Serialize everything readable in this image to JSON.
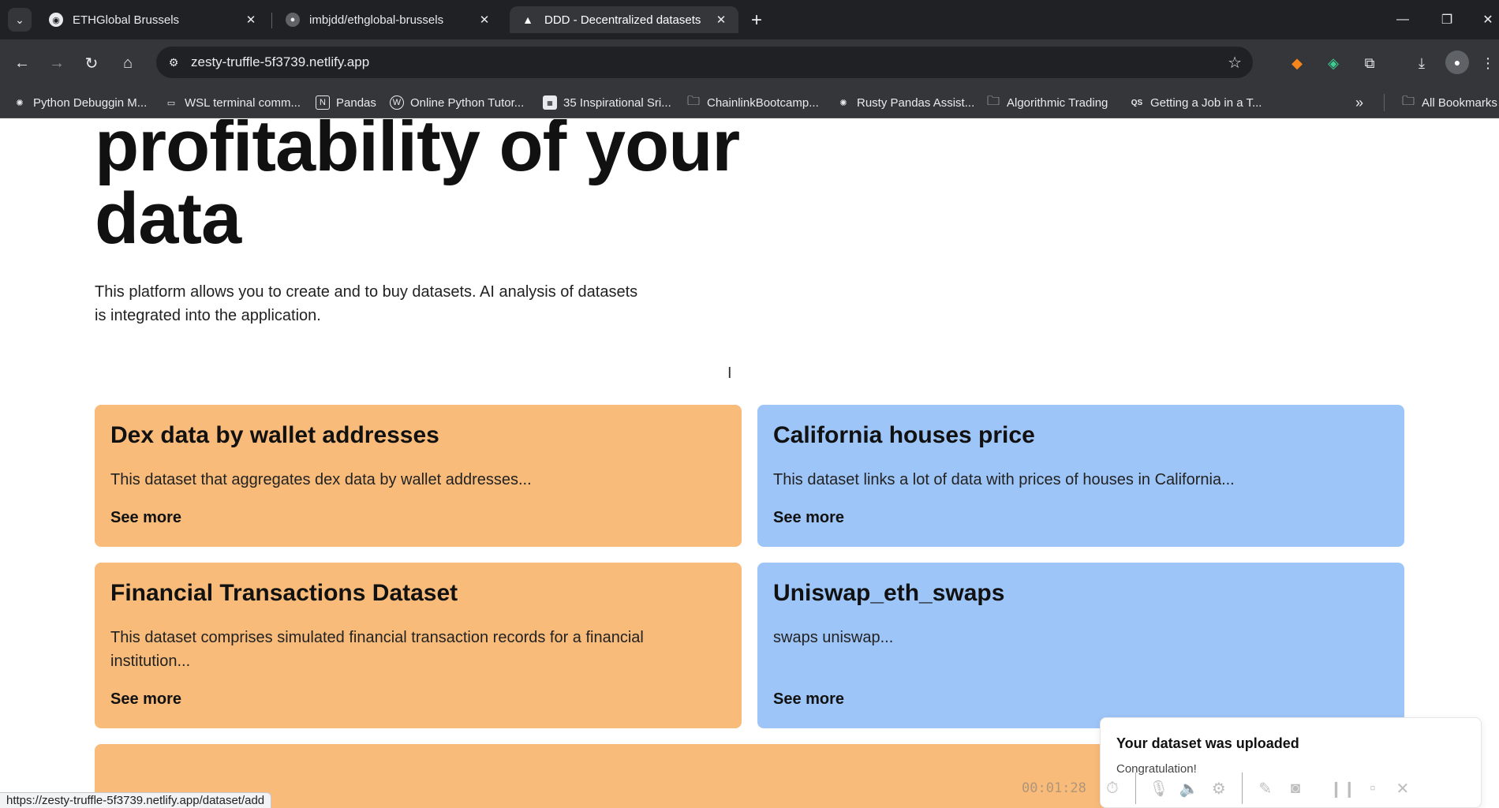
{
  "tabs": [
    {
      "title": "ETHGlobal Brussels",
      "favicon": "ethglobal-icon"
    },
    {
      "title": "imbjdd/ethglobal-brussels",
      "favicon": "github-icon"
    },
    {
      "title": "DDD - Decentralized datasets",
      "favicon": "netlify-triangle-icon"
    }
  ],
  "address": {
    "url": "zesty-truffle-5f3739.netlify.app"
  },
  "bookmarks": [
    {
      "label": "Python Debuggin M...",
      "icon": "openai-icon"
    },
    {
      "label": "WSL terminal comm...",
      "icon": "keyboard-icon"
    },
    {
      "label": "Pandas",
      "icon": "notion-icon"
    },
    {
      "label": "Online Python Tutor...",
      "icon": "wordpress-icon"
    },
    {
      "label": "35 Inspirational Sri...",
      "icon": "site-icon"
    },
    {
      "label": "ChainlinkBootcamp...",
      "icon": "folder-icon"
    },
    {
      "label": "Rusty Pandas Assist...",
      "icon": "openai-icon"
    },
    {
      "label": "Algorithmic Trading",
      "icon": "folder-icon"
    },
    {
      "label": "Getting a Job in a T...",
      "icon": "qs-icon"
    }
  ],
  "bookmarks_all": "All Bookmarks",
  "hero": {
    "line1": "profitability of your",
    "line2": "data"
  },
  "intro": "This platform allows you to create and to buy datasets. AI analysis of datasets is integrated into the application.",
  "datasets": [
    {
      "title": "Dex data by wallet addresses",
      "description": "This dataset that aggregates dex data by wallet addresses...",
      "link": "See more",
      "color": "#f8bb7a"
    },
    {
      "title": "California houses price",
      "description": "This dataset links a lot of data with prices of houses in California...",
      "link": "See more",
      "color": "#9ec5f8"
    },
    {
      "title": "Financial Transactions Dataset",
      "description": "This dataset comprises simulated financial transaction records for a financial institution...",
      "link": "See more",
      "color": "#f8bb7a"
    },
    {
      "title": "Uniswap_eth_swaps",
      "description": "swaps uniswap...",
      "link": "See more",
      "color": "#9ec5f8"
    }
  ],
  "toast": {
    "title": "Your dataset was uploaded",
    "body": "Congratulation!"
  },
  "recorder": {
    "time": "00:01:28"
  },
  "status_url": "https://zesty-truffle-5f3739.netlify.app/dataset/add"
}
